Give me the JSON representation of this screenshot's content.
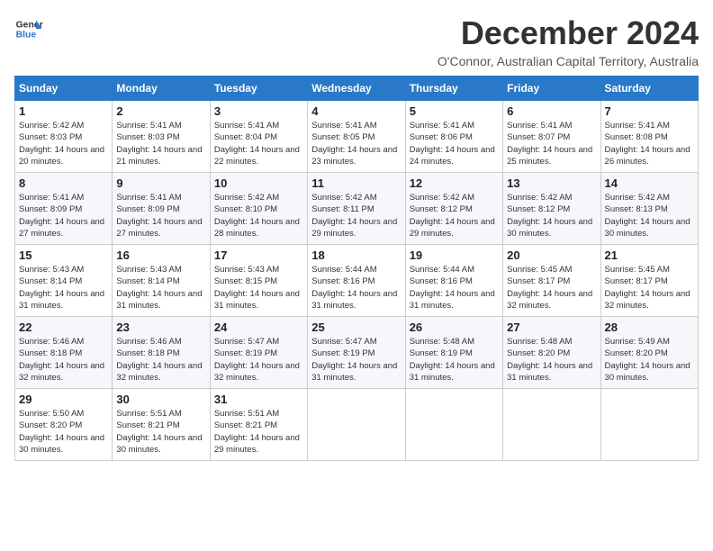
{
  "header": {
    "logo_line1": "General",
    "logo_line2": "Blue",
    "month_title": "December 2024",
    "location": "O'Connor, Australian Capital Territory, Australia"
  },
  "days_of_week": [
    "Sunday",
    "Monday",
    "Tuesday",
    "Wednesday",
    "Thursday",
    "Friday",
    "Saturday"
  ],
  "weeks": [
    [
      {
        "day": "1",
        "sunrise": "Sunrise: 5:42 AM",
        "sunset": "Sunset: 8:03 PM",
        "daylight": "Daylight: 14 hours and 20 minutes."
      },
      {
        "day": "2",
        "sunrise": "Sunrise: 5:41 AM",
        "sunset": "Sunset: 8:03 PM",
        "daylight": "Daylight: 14 hours and 21 minutes."
      },
      {
        "day": "3",
        "sunrise": "Sunrise: 5:41 AM",
        "sunset": "Sunset: 8:04 PM",
        "daylight": "Daylight: 14 hours and 22 minutes."
      },
      {
        "day": "4",
        "sunrise": "Sunrise: 5:41 AM",
        "sunset": "Sunset: 8:05 PM",
        "daylight": "Daylight: 14 hours and 23 minutes."
      },
      {
        "day": "5",
        "sunrise": "Sunrise: 5:41 AM",
        "sunset": "Sunset: 8:06 PM",
        "daylight": "Daylight: 14 hours and 24 minutes."
      },
      {
        "day": "6",
        "sunrise": "Sunrise: 5:41 AM",
        "sunset": "Sunset: 8:07 PM",
        "daylight": "Daylight: 14 hours and 25 minutes."
      },
      {
        "day": "7",
        "sunrise": "Sunrise: 5:41 AM",
        "sunset": "Sunset: 8:08 PM",
        "daylight": "Daylight: 14 hours and 26 minutes."
      }
    ],
    [
      {
        "day": "8",
        "sunrise": "Sunrise: 5:41 AM",
        "sunset": "Sunset: 8:09 PM",
        "daylight": "Daylight: 14 hours and 27 minutes."
      },
      {
        "day": "9",
        "sunrise": "Sunrise: 5:41 AM",
        "sunset": "Sunset: 8:09 PM",
        "daylight": "Daylight: 14 hours and 27 minutes."
      },
      {
        "day": "10",
        "sunrise": "Sunrise: 5:42 AM",
        "sunset": "Sunset: 8:10 PM",
        "daylight": "Daylight: 14 hours and 28 minutes."
      },
      {
        "day": "11",
        "sunrise": "Sunrise: 5:42 AM",
        "sunset": "Sunset: 8:11 PM",
        "daylight": "Daylight: 14 hours and 29 minutes."
      },
      {
        "day": "12",
        "sunrise": "Sunrise: 5:42 AM",
        "sunset": "Sunset: 8:12 PM",
        "daylight": "Daylight: 14 hours and 29 minutes."
      },
      {
        "day": "13",
        "sunrise": "Sunrise: 5:42 AM",
        "sunset": "Sunset: 8:12 PM",
        "daylight": "Daylight: 14 hours and 30 minutes."
      },
      {
        "day": "14",
        "sunrise": "Sunrise: 5:42 AM",
        "sunset": "Sunset: 8:13 PM",
        "daylight": "Daylight: 14 hours and 30 minutes."
      }
    ],
    [
      {
        "day": "15",
        "sunrise": "Sunrise: 5:43 AM",
        "sunset": "Sunset: 8:14 PM",
        "daylight": "Daylight: 14 hours and 31 minutes."
      },
      {
        "day": "16",
        "sunrise": "Sunrise: 5:43 AM",
        "sunset": "Sunset: 8:14 PM",
        "daylight": "Daylight: 14 hours and 31 minutes."
      },
      {
        "day": "17",
        "sunrise": "Sunrise: 5:43 AM",
        "sunset": "Sunset: 8:15 PM",
        "daylight": "Daylight: 14 hours and 31 minutes."
      },
      {
        "day": "18",
        "sunrise": "Sunrise: 5:44 AM",
        "sunset": "Sunset: 8:16 PM",
        "daylight": "Daylight: 14 hours and 31 minutes."
      },
      {
        "day": "19",
        "sunrise": "Sunrise: 5:44 AM",
        "sunset": "Sunset: 8:16 PM",
        "daylight": "Daylight: 14 hours and 31 minutes."
      },
      {
        "day": "20",
        "sunrise": "Sunrise: 5:45 AM",
        "sunset": "Sunset: 8:17 PM",
        "daylight": "Daylight: 14 hours and 32 minutes."
      },
      {
        "day": "21",
        "sunrise": "Sunrise: 5:45 AM",
        "sunset": "Sunset: 8:17 PM",
        "daylight": "Daylight: 14 hours and 32 minutes."
      }
    ],
    [
      {
        "day": "22",
        "sunrise": "Sunrise: 5:46 AM",
        "sunset": "Sunset: 8:18 PM",
        "daylight": "Daylight: 14 hours and 32 minutes."
      },
      {
        "day": "23",
        "sunrise": "Sunrise: 5:46 AM",
        "sunset": "Sunset: 8:18 PM",
        "daylight": "Daylight: 14 hours and 32 minutes."
      },
      {
        "day": "24",
        "sunrise": "Sunrise: 5:47 AM",
        "sunset": "Sunset: 8:19 PM",
        "daylight": "Daylight: 14 hours and 32 minutes."
      },
      {
        "day": "25",
        "sunrise": "Sunrise: 5:47 AM",
        "sunset": "Sunset: 8:19 PM",
        "daylight": "Daylight: 14 hours and 31 minutes."
      },
      {
        "day": "26",
        "sunrise": "Sunrise: 5:48 AM",
        "sunset": "Sunset: 8:19 PM",
        "daylight": "Daylight: 14 hours and 31 minutes."
      },
      {
        "day": "27",
        "sunrise": "Sunrise: 5:48 AM",
        "sunset": "Sunset: 8:20 PM",
        "daylight": "Daylight: 14 hours and 31 minutes."
      },
      {
        "day": "28",
        "sunrise": "Sunrise: 5:49 AM",
        "sunset": "Sunset: 8:20 PM",
        "daylight": "Daylight: 14 hours and 30 minutes."
      }
    ],
    [
      {
        "day": "29",
        "sunrise": "Sunrise: 5:50 AM",
        "sunset": "Sunset: 8:20 PM",
        "daylight": "Daylight: 14 hours and 30 minutes."
      },
      {
        "day": "30",
        "sunrise": "Sunrise: 5:51 AM",
        "sunset": "Sunset: 8:21 PM",
        "daylight": "Daylight: 14 hours and 30 minutes."
      },
      {
        "day": "31",
        "sunrise": "Sunrise: 5:51 AM",
        "sunset": "Sunset: 8:21 PM",
        "daylight": "Daylight: 14 hours and 29 minutes."
      },
      null,
      null,
      null,
      null
    ]
  ]
}
